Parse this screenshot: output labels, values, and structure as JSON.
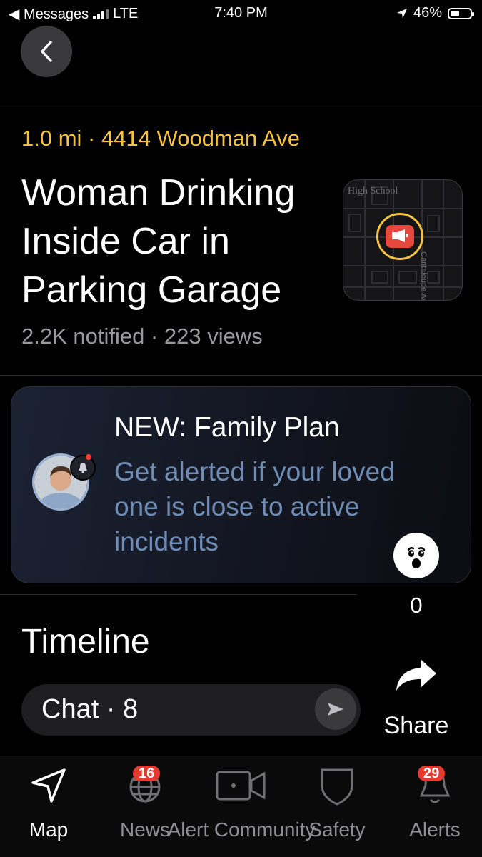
{
  "status_bar": {
    "carrier": "◀ Messages",
    "network": "LTE",
    "time": "7:40 PM",
    "battery": "46%",
    "battery_level": 0.46
  },
  "incident": {
    "meta": "1.0 mi · 4414 Woodman Ave",
    "title": "Woman Drinking Inside Car in Parking Garage",
    "stats": "2.2K notified · 223 views",
    "map_label": "High School",
    "map_street": "Cantaloupe Ave"
  },
  "promo": {
    "title": "NEW: Family Plan",
    "subtitle": "Get alerted if your loved one is close to active incidents"
  },
  "reaction": {
    "count": "0",
    "icon": "shocked-face-icon"
  },
  "timeline": {
    "heading": "Timeline",
    "chat_label": "Chat · 8"
  },
  "share": {
    "label": "Share"
  },
  "tabs": [
    {
      "label": "Map",
      "icon": "navigation-arrow-icon",
      "active": true
    },
    {
      "label": "News",
      "icon": "globe-icon",
      "badge": "16"
    },
    {
      "label": "Alert Community",
      "icon": "video-camera-icon"
    },
    {
      "label": "Safety",
      "icon": "shield-icon"
    },
    {
      "label": "Alerts",
      "icon": "bell-icon",
      "badge": "29"
    }
  ],
  "colors": {
    "accent": "#f5c242",
    "promo_text": "#6f8cb5",
    "badge": "#e8392f",
    "background": "#000000"
  }
}
